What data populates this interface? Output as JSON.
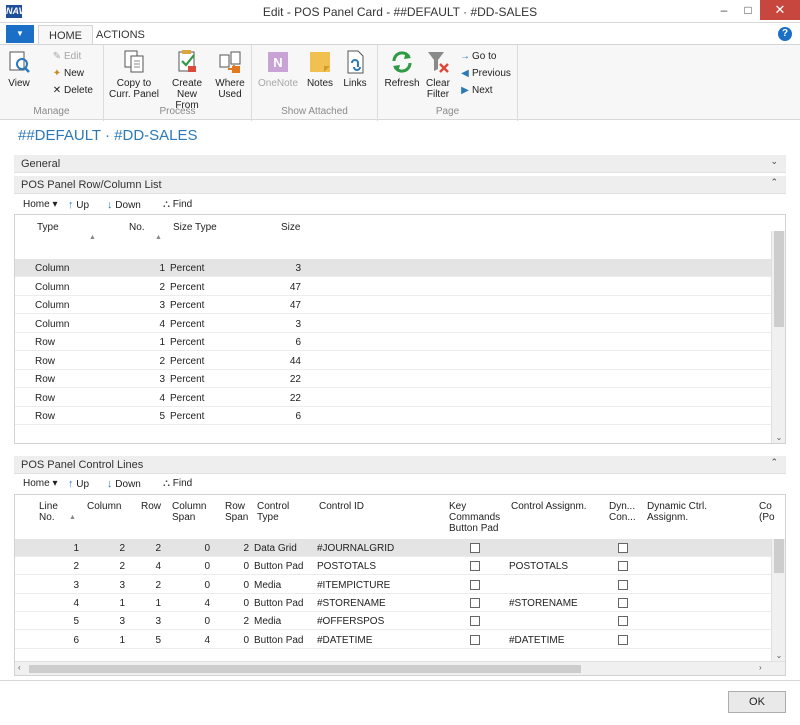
{
  "window": {
    "logo": "NAV",
    "title": "Edit - POS Panel Card - ##DEFAULT · #DD-SALES",
    "minimize": "–",
    "maximize": "□",
    "close": "✕"
  },
  "tabs": {
    "app_menu": "▼",
    "home": "HOME",
    "actions": "ACTIONS",
    "help": "?"
  },
  "ribbon": {
    "manage": {
      "title": "Manage",
      "view": "View",
      "edit": "Edit",
      "new": "New",
      "delete": "Delete"
    },
    "process": {
      "title": "Process",
      "copy_line1": "Copy to",
      "copy_line2": "Curr. Panel",
      "create_line1": "Create",
      "create_line2": "New From",
      "where_line1": "Where",
      "where_line2": "Used"
    },
    "show_attached": {
      "title": "Show Attached",
      "onenote": "OneNote",
      "notes": "Notes",
      "links": "Links"
    },
    "page": {
      "title": "Page",
      "refresh": "Refresh",
      "clear_line1": "Clear",
      "clear_line2": "Filter",
      "goto": "Go to",
      "previous": "Previous",
      "next": "Next"
    }
  },
  "page_heading": "##DEFAULT · #DD-SALES",
  "general_tab": {
    "label": "General",
    "chevron": "⌄"
  },
  "rowcol": {
    "label": "POS Panel Row/Column List",
    "chevron": "⌃",
    "toolbar": {
      "home": "Home",
      "home_arrow": "▾",
      "up": "Up",
      "down": "Down",
      "find": "Find"
    },
    "headers": {
      "type": "Type",
      "no": "No.",
      "size_type": "Size Type",
      "size": "Size"
    },
    "rows": [
      {
        "type": "Column",
        "no": "1",
        "size_type": "Percent",
        "size": "3"
      },
      {
        "type": "Column",
        "no": "2",
        "size_type": "Percent",
        "size": "47"
      },
      {
        "type": "Column",
        "no": "3",
        "size_type": "Percent",
        "size": "47"
      },
      {
        "type": "Column",
        "no": "4",
        "size_type": "Percent",
        "size": "3"
      },
      {
        "type": "Row",
        "no": "1",
        "size_type": "Percent",
        "size": "6"
      },
      {
        "type": "Row",
        "no": "2",
        "size_type": "Percent",
        "size": "44"
      },
      {
        "type": "Row",
        "no": "3",
        "size_type": "Percent",
        "size": "22"
      },
      {
        "type": "Row",
        "no": "4",
        "size_type": "Percent",
        "size": "22"
      },
      {
        "type": "Row",
        "no": "5",
        "size_type": "Percent",
        "size": "6"
      }
    ]
  },
  "control": {
    "label": "POS Panel Control Lines",
    "chevron": "⌃",
    "toolbar": {
      "home": "Home",
      "home_arrow": "▾",
      "up": "Up",
      "down": "Down",
      "find": "Find"
    },
    "headers": {
      "line_no_1": "Line",
      "line_no_2": "No.",
      "column": "Column",
      "row": "Row",
      "col_span_1": "Column",
      "col_span_2": "Span",
      "row_span_1": "Row",
      "row_span_2": "Span",
      "ctrl_type_1": "Control",
      "ctrl_type_2": "Type",
      "control_id": "Control ID",
      "key_cmd_1": "Key",
      "key_cmd_2": "Commands",
      "key_cmd_3": "Button Pad",
      "assignm": "Control Assignm.",
      "dyn_1": "Dyn...",
      "dyn_2": "Con...",
      "dyn_assign_1": "Dynamic Ctrl.",
      "dyn_assign_2": "Assignm.",
      "co_1": "Co",
      "co_2": "(Po"
    },
    "rows": [
      {
        "line": "1",
        "column": "2",
        "row": "2",
        "col_span": "0",
        "row_span": "2",
        "ctrl_type": "Data Grid",
        "control_id": "#JOURNALGRID",
        "assignm": "",
        "key_cmd": false,
        "dyn": false
      },
      {
        "line": "2",
        "column": "2",
        "row": "4",
        "col_span": "0",
        "row_span": "0",
        "ctrl_type": "Button Pad",
        "control_id": "POSTOTALS",
        "assignm": "POSTOTALS",
        "key_cmd": false,
        "dyn": false
      },
      {
        "line": "3",
        "column": "3",
        "row": "2",
        "col_span": "0",
        "row_span": "0",
        "ctrl_type": "Media",
        "control_id": "#ITEMPICTURE",
        "assignm": "",
        "key_cmd": false,
        "dyn": false
      },
      {
        "line": "4",
        "column": "1",
        "row": "1",
        "col_span": "4",
        "row_span": "0",
        "ctrl_type": "Button Pad",
        "control_id": "#STORENAME",
        "assignm": "#STORENAME",
        "key_cmd": false,
        "dyn": false
      },
      {
        "line": "5",
        "column": "3",
        "row": "3",
        "col_span": "0",
        "row_span": "2",
        "ctrl_type": "Media",
        "control_id": "#OFFERSPOS",
        "assignm": "",
        "key_cmd": false,
        "dyn": false
      },
      {
        "line": "6",
        "column": "1",
        "row": "5",
        "col_span": "4",
        "row_span": "0",
        "ctrl_type": "Button Pad",
        "control_id": "#DATETIME",
        "assignm": "#DATETIME",
        "key_cmd": false,
        "dyn": false
      }
    ]
  },
  "ok_button": "OK"
}
